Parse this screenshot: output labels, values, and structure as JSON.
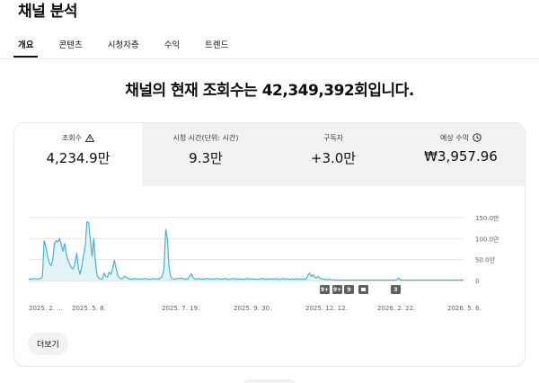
{
  "page": {
    "title": "채널 분석"
  },
  "tabs": [
    {
      "label": "개요",
      "active": true
    },
    {
      "label": "콘텐츠",
      "active": false
    },
    {
      "label": "시청자층",
      "active": false
    },
    {
      "label": "수익",
      "active": false
    },
    {
      "label": "트렌드",
      "active": false
    }
  ],
  "headline": "채널의 현재 조회수는 42,349,392회입니다.",
  "stats": [
    {
      "label": "조회수",
      "value": "4,234.9만",
      "icon": "warning-icon"
    },
    {
      "label": "시청 시간(단위: 시간)",
      "value": "9.3만"
    },
    {
      "label": "구독자",
      "value": "+3.0만"
    },
    {
      "label": "예상 수익",
      "value": "₩3,957.96",
      "icon": "clock-icon"
    }
  ],
  "more_button": "더보기",
  "colors": {
    "line": "#41b4d2",
    "fill": "#e3f4f9",
    "grid": "#e5e5e5",
    "badge": "#606060"
  },
  "chart_data": {
    "type": "area",
    "x_tick_labels": [
      "2025. 2. ...",
      "2025. 5. 8.",
      "2025. 7. 19.",
      "2025. 9. 30.",
      "2025. 12. 12.",
      "2026. 2. 22.",
      "2026. 5. 6."
    ],
    "y_tick_labels": [
      "150.0만",
      "100.0만",
      "50.0만",
      "0"
    ],
    "ylim": [
      0,
      150
    ],
    "markers": [
      "9+",
      "9+",
      "9",
      "video-icon",
      "3"
    ],
    "series": [
      {
        "values": [
          3,
          4,
          3,
          5,
          4,
          3,
          4,
          5,
          10,
          95,
          80,
          58,
          42,
          35,
          48,
          88,
          95,
          92,
          100,
          85,
          70,
          88,
          62,
          48,
          38,
          30,
          28,
          40,
          65,
          30,
          15,
          34,
          60,
          82,
          140,
          138,
          95,
          58,
          100,
          42,
          12,
          5,
          4,
          3,
          18,
          10,
          8,
          20,
          15,
          28,
          48,
          30,
          12,
          6,
          4,
          5,
          10,
          8,
          5,
          3,
          4,
          3,
          5,
          4,
          3,
          4,
          3,
          4,
          5,
          4,
          3,
          3,
          4,
          5,
          3,
          4,
          3,
          6,
          10,
          28,
          122,
          98,
          30,
          8,
          4,
          3,
          4,
          5,
          4,
          6,
          5,
          3,
          4,
          3,
          10,
          16,
          6,
          4,
          3,
          5,
          4,
          3,
          4,
          3,
          5,
          4,
          3,
          4,
          3,
          4,
          5,
          3,
          4,
          3,
          4,
          5,
          3,
          3,
          4,
          4,
          5,
          3,
          4,
          3,
          4,
          3,
          3,
          4,
          5,
          3,
          4,
          3,
          4,
          3,
          3,
          4,
          5,
          4,
          3,
          3,
          4,
          3,
          4,
          3,
          5,
          4,
          3,
          3,
          4,
          5,
          3,
          4,
          3,
          3,
          4,
          3,
          4,
          3,
          4,
          3,
          3,
          4,
          3,
          12,
          18,
          10,
          14,
          8,
          6,
          10,
          5,
          4,
          3,
          3,
          2,
          2,
          3,
          2,
          1,
          1,
          1,
          1,
          1,
          1,
          1,
          1,
          1,
          1,
          1,
          1,
          1,
          1,
          1,
          1,
          1,
          1,
          1,
          1,
          1,
          1,
          1,
          1,
          1,
          1,
          1,
          1,
          1,
          1,
          1,
          1,
          1,
          1,
          1,
          1,
          1,
          1,
          6,
          1,
          1,
          1,
          1,
          1,
          1,
          1,
          1,
          1,
          1,
          1,
          1,
          1,
          1,
          1,
          1,
          1,
          1,
          1,
          1,
          1,
          1,
          1,
          1,
          1,
          1,
          1,
          1,
          1,
          1,
          1,
          1,
          1,
          1,
          1,
          1,
          1,
          1
        ]
      }
    ]
  }
}
